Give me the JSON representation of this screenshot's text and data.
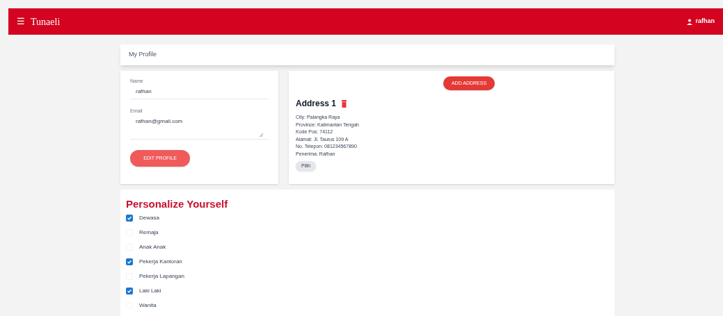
{
  "app_bar": {
    "title": "Tunaeli",
    "menu_icon": "☰",
    "user": "rafhan"
  },
  "page_title": "My Profile",
  "profile": {
    "name_label": "Name",
    "name_value": "rafhan",
    "email_label": "Email",
    "email_value": "rafhan@gmail.com",
    "button": "EDIT PROFILE"
  },
  "addresses": {
    "add_button": "ADD ADDRESS",
    "items": [
      {
        "title": "Address 1",
        "lines": [
          "City: Palangka Raya",
          "Province: Kalimantan Tengah",
          "Kode Pos: 74112",
          "Alamat: Jl. Taurus 109 A",
          "No. Telepon: 081234567890",
          "Penerima: Rafhan"
        ],
        "button": "Pilih"
      }
    ]
  },
  "personalize": {
    "title": "Personalize Yourself",
    "options": [
      {
        "label": "Dewasa",
        "checked": true
      },
      {
        "label": "Remaja",
        "checked": false
      },
      {
        "label": "Anak Anak",
        "checked": false
      },
      {
        "label": "Pekerja Kantoran",
        "checked": true
      },
      {
        "label": "Pekerja Lapangan",
        "checked": false
      },
      {
        "label": "Laki Laki",
        "checked": true
      },
      {
        "label": "Wanita",
        "checked": false
      }
    ]
  }
}
